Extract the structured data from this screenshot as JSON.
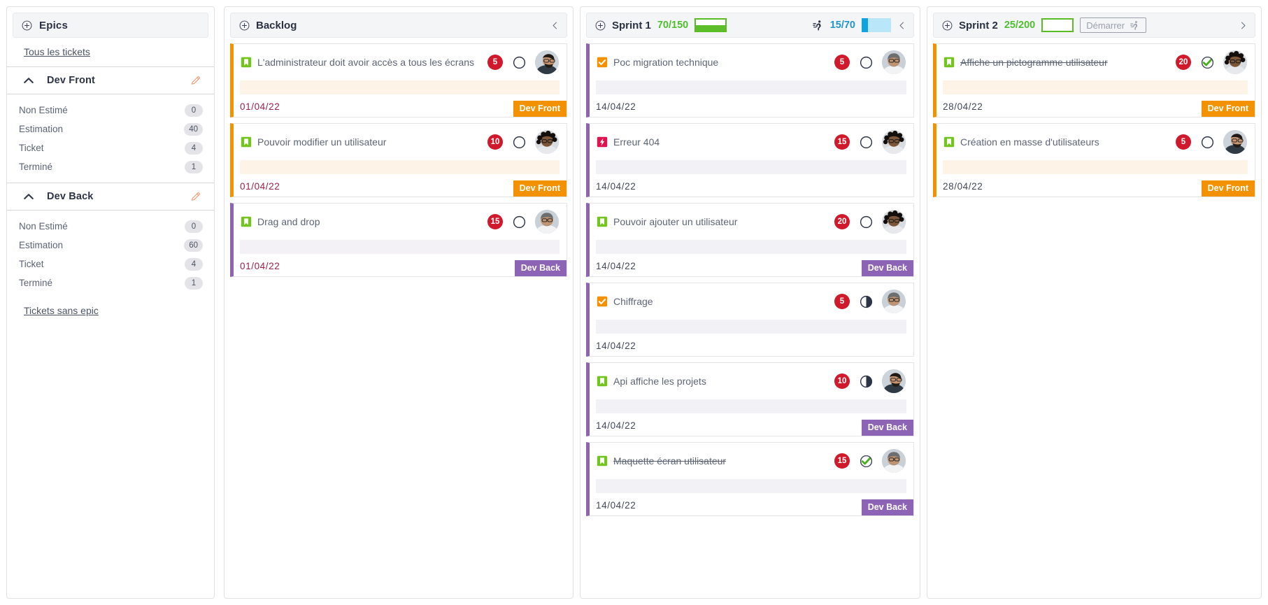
{
  "sidebar": {
    "header": {
      "title": "Epics",
      "add_icon": "plus-circle-icon"
    },
    "all_tickets_link": "Tous les tickets",
    "no_epic_link": "Tickets sans epic",
    "stat_labels": [
      "Non Estimé",
      "Estimation",
      "Ticket",
      "Terminé"
    ],
    "epics": [
      {
        "name": "Dev Front",
        "collapse_icon": "chevron-up-icon",
        "edit_icon": "pencil-icon",
        "stats": [
          {
            "label": "Non Estimé",
            "value": "0"
          },
          {
            "label": "Estimation",
            "value": "40"
          },
          {
            "label": "Ticket",
            "value": "4"
          },
          {
            "label": "Terminé",
            "value": "1"
          }
        ]
      },
      {
        "name": "Dev Back",
        "collapse_icon": "chevron-up-icon",
        "edit_icon": "pencil-icon",
        "stats": [
          {
            "label": "Non Estimé",
            "value": "0"
          },
          {
            "label": "Estimation",
            "value": "60"
          },
          {
            "label": "Ticket",
            "value": "4"
          },
          {
            "label": "Terminé",
            "value": "1"
          }
        ]
      }
    ]
  },
  "colors": {
    "epic_front": "#f39200",
    "epic_back": "#8c63b5",
    "estimate_badge": "#d0192b",
    "points_green": "#4fbe2f",
    "velocity_blue": "#2196c9",
    "date_backlog": "#9c2147",
    "date_sprint": "#41485a",
    "bug_crimson": "#e0114e",
    "task_orange": "#f59100",
    "story_green": "#73c41d",
    "done_green": "#4caf20"
  },
  "columns": [
    {
      "id": "backlog",
      "title": "Backlog",
      "add_icon": "plus-circle-icon",
      "points": "",
      "capacity_fill_pct": 0,
      "show_points": false,
      "show_velocity": false,
      "collapse_icon": "chevron-left-icon",
      "cards": [
        {
          "title": "L'administrateur doit avoir accès a tous les écrans",
          "type_icon": "story-bookmark-icon",
          "estimate": "5",
          "status_icon": "circle-empty-icon",
          "status": "todo",
          "date": "01/04/22",
          "date_style": "red",
          "epic": "Dev Front",
          "epic_class": "front",
          "band": "band-front",
          "avatar": "avatar-man-beard-glasses",
          "done": false
        },
        {
          "title": "Pouvoir modifier un utilisateur",
          "type_icon": "story-bookmark-icon",
          "estimate": "10",
          "status_icon": "circle-empty-icon",
          "status": "todo",
          "date": "01/04/22",
          "date_style": "red",
          "epic": "Dev Front",
          "epic_class": "front",
          "band": "band-front",
          "avatar": "avatar-woman-curly-glasses",
          "done": false
        },
        {
          "title": "Drag and drop",
          "type_icon": "story-bookmark-icon",
          "estimate": "15",
          "status_icon": "circle-empty-icon",
          "status": "todo",
          "date": "01/04/22",
          "date_style": "red",
          "epic": "Dev Back",
          "epic_class": "back",
          "band": "band-back",
          "avatar": "avatar-man-bald-glasses",
          "done": false
        }
      ]
    },
    {
      "id": "sprint1",
      "title": "Sprint 1",
      "add_icon": "plus-circle-icon",
      "points": "70/150",
      "capacity_fill_pct": 47,
      "show_points": true,
      "show_velocity": true,
      "velocity_icon": "runner-icon",
      "velocity": "15/70",
      "velocity_fill_pct": 21,
      "collapse_icon": "chevron-left-icon",
      "cards": [
        {
          "title": "Poc migration technique",
          "type_icon": "task-check-icon",
          "estimate": "5",
          "status_icon": "circle-empty-icon",
          "status": "todo",
          "date": "14/04/22",
          "date_style": "dark",
          "epic": "",
          "epic_class": "",
          "band": "band-grey",
          "avatar": "avatar-man-bald-glasses",
          "done": false
        },
        {
          "title": "Erreur 404",
          "type_icon": "bug-bolt-icon",
          "estimate": "15",
          "status_icon": "circle-empty-icon",
          "status": "todo",
          "date": "14/04/22",
          "date_style": "dark",
          "epic": "",
          "epic_class": "",
          "band": "band-grey",
          "avatar": "avatar-woman-curly-glasses",
          "done": false
        },
        {
          "title": "Pouvoir ajouter un utilisateur",
          "type_icon": "story-bookmark-icon",
          "estimate": "20",
          "status_icon": "circle-empty-icon",
          "status": "todo",
          "date": "14/04/22",
          "date_style": "dark",
          "epic": "Dev Back",
          "epic_class": "back",
          "band": "band-grey",
          "avatar": "avatar-woman-curly-glasses",
          "done": false
        },
        {
          "title": "Chiffrage",
          "type_icon": "task-check-icon",
          "estimate": "5",
          "status_icon": "circle-half-icon",
          "status": "in-progress",
          "date": "14/04/22",
          "date_style": "dark",
          "epic": "",
          "epic_class": "",
          "band": "band-grey",
          "avatar": "avatar-man-bald-glasses",
          "done": false
        },
        {
          "title": "Api affiche les projets",
          "type_icon": "story-bookmark-icon",
          "estimate": "10",
          "status_icon": "circle-half-icon",
          "status": "in-progress",
          "date": "14/04/22",
          "date_style": "dark",
          "epic": "Dev Back",
          "epic_class": "back",
          "band": "band-grey",
          "avatar": "avatar-man-beard-glasses",
          "done": false
        },
        {
          "title": "Maquette écran utilisateur",
          "type_icon": "story-bookmark-icon",
          "estimate": "15",
          "status_icon": "circle-check-icon",
          "status": "done",
          "date": "14/04/22",
          "date_style": "dark",
          "epic": "Dev Back",
          "epic_class": "back",
          "band": "band-grey",
          "avatar": "avatar-man-bald-glasses",
          "done": true
        }
      ]
    },
    {
      "id": "sprint2",
      "title": "Sprint 2",
      "add_icon": "plus-circle-icon",
      "points": "25/200",
      "capacity_fill_pct": 0,
      "show_points": true,
      "show_velocity": false,
      "start_button": {
        "label": "Démarrer",
        "icon": "runner-icon"
      },
      "collapse_icon": "chevron-right-icon",
      "cards": [
        {
          "title": "Affiche un pictogramme utilisateur",
          "type_icon": "story-bookmark-icon",
          "estimate": "20",
          "status_icon": "circle-check-icon",
          "status": "done",
          "date": "28/04/22",
          "date_style": "dark",
          "epic": "Dev Front",
          "epic_class": "front",
          "band": "band-front",
          "avatar": "avatar-woman-curly-glasses",
          "done": true
        },
        {
          "title": "Création en masse d'utilisateurs",
          "type_icon": "story-bookmark-icon",
          "estimate": "5",
          "status_icon": "circle-empty-icon",
          "status": "todo",
          "date": "28/04/22",
          "date_style": "dark",
          "epic": "Dev Front",
          "epic_class": "front",
          "band": "band-front",
          "avatar": "avatar-man-beard-glasses",
          "done": false
        }
      ]
    }
  ]
}
